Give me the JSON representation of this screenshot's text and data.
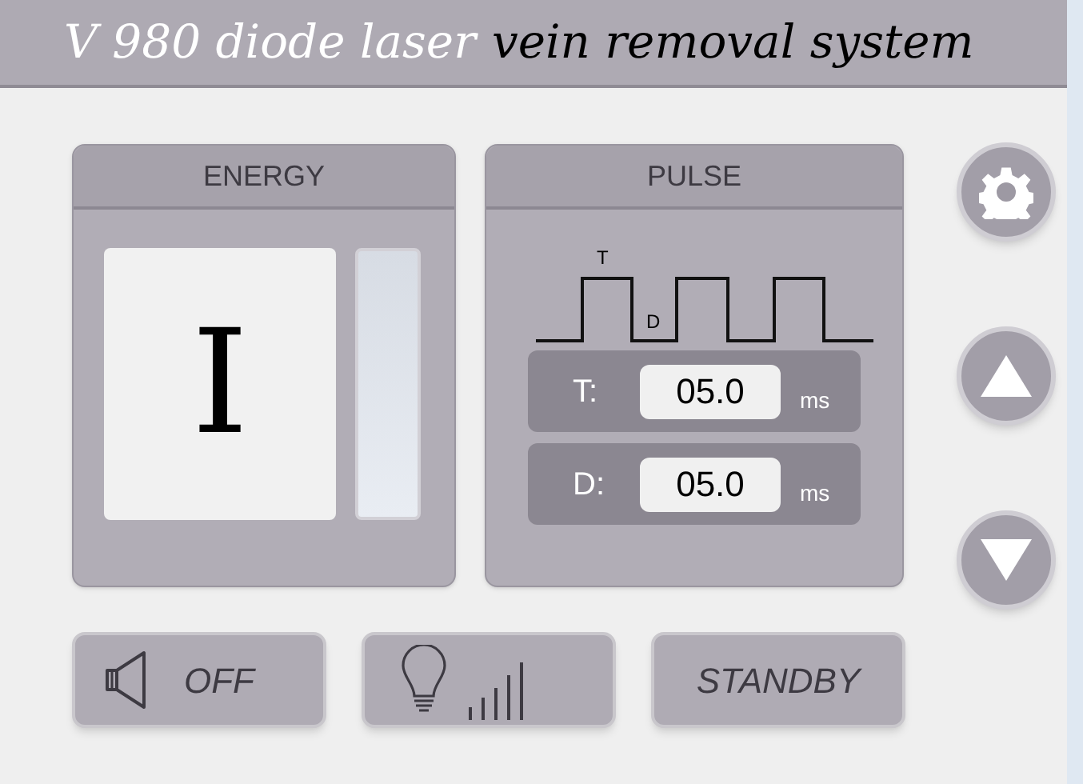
{
  "title": {
    "light": "V 980 diode laser",
    "dark": "vein removal system"
  },
  "energy": {
    "header": "ENERGY",
    "level_display": "I"
  },
  "pulse": {
    "header": "PULSE",
    "wave_labels": [
      "T",
      "D"
    ],
    "rows": [
      {
        "label": "T:",
        "value": "05.0",
        "unit": "ms"
      },
      {
        "label": "D:",
        "value": "05.0",
        "unit": "ms"
      }
    ]
  },
  "side_buttons": [
    {
      "kind": "settings"
    },
    {
      "kind": "up"
    },
    {
      "kind": "down"
    }
  ],
  "bottom_buttons": [
    {
      "kind": "sound",
      "label": "OFF"
    },
    {
      "kind": "light"
    },
    {
      "kind": "text",
      "label": "STANDBY"
    }
  ]
}
